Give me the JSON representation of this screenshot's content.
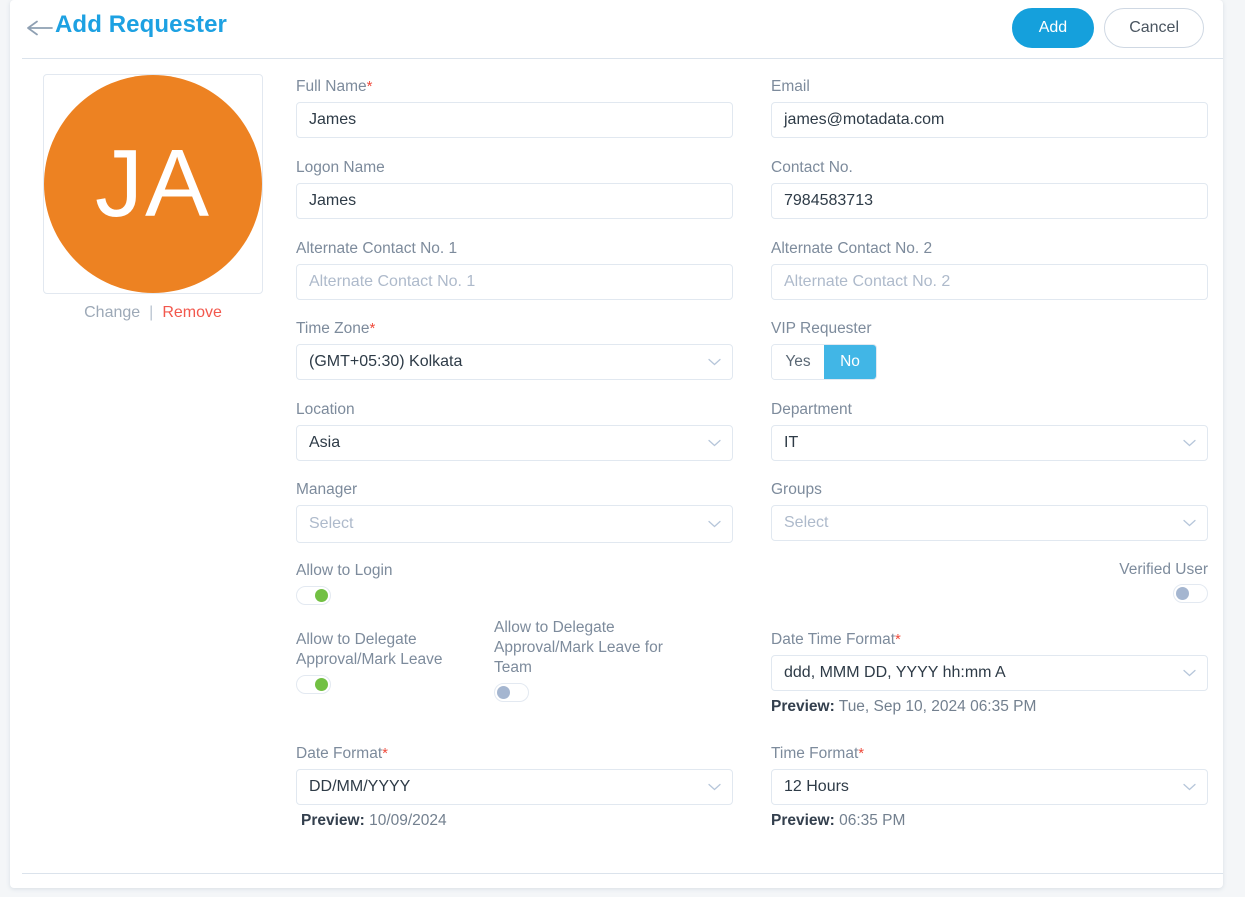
{
  "header": {
    "back_icon": "arrow-left-icon",
    "title": "Add Requester",
    "add_label": "Add",
    "cancel_label": "Cancel"
  },
  "avatar": {
    "initials": "JA",
    "color": "#ED8222",
    "change_label": "Change",
    "separator": "|",
    "remove_label": "Remove"
  },
  "form": {
    "full_name": {
      "label": "Full Name",
      "required": "*",
      "value": "James"
    },
    "email": {
      "label": "Email",
      "value": "james@motadata.com"
    },
    "logon_name": {
      "label": "Logon Name",
      "value": "James"
    },
    "contact_no": {
      "label": "Contact No.",
      "value": "7984583713"
    },
    "alternate_contact_1": {
      "label": "Alternate Contact No. 1",
      "placeholder": "Alternate Contact No. 1",
      "value": ""
    },
    "alternate_contact_2": {
      "label": "Alternate Contact No. 2",
      "placeholder": "Alternate Contact No. 2",
      "value": ""
    },
    "time_zone": {
      "label": "Time Zone",
      "required": "*",
      "value": "(GMT+05:30) Kolkata"
    },
    "vip_requester": {
      "label": "VIP Requester",
      "yes_label": "Yes",
      "no_label": "No",
      "selected": "No"
    },
    "location": {
      "label": "Location",
      "value": "Asia"
    },
    "department": {
      "label": "Department",
      "value": "IT"
    },
    "manager": {
      "label": "Manager",
      "placeholder": "Select"
    },
    "groups": {
      "label": "Groups",
      "placeholder": "Select"
    },
    "allow_to_login": {
      "label": "Allow to Login",
      "state": "on"
    },
    "verified_user": {
      "label": "Verified User",
      "state": "off"
    },
    "allow_delegate": {
      "label": "Allow to Delegate Approval/Mark Leave",
      "state": "on"
    },
    "allow_delegate_team": {
      "label": "Allow to Delegate Approval/Mark Leave for Team",
      "state": "off"
    },
    "date_time_format": {
      "label": "Date Time Format",
      "required": "*",
      "value": "ddd, MMM DD, YYYY hh:mm A",
      "preview_label": "Preview:",
      "preview_value": "Tue, Sep 10, 2024 06:35 PM"
    },
    "date_format": {
      "label": "Date Format",
      "required": "*",
      "value": "DD/MM/YYYY",
      "preview_label": "Preview:",
      "preview_value": "10/09/2024"
    },
    "time_format": {
      "label": "Time Format",
      "required": "*",
      "value": "12 Hours",
      "preview_label": "Preview:",
      "preview_value": "06:35 PM"
    }
  },
  "colors": {
    "accent": "#15A0DC",
    "title": "#1DA1E2",
    "avatar": "#ED8222",
    "toggle_on": "#72C043",
    "toggle_off": "#a5b6d0",
    "remove": "#F2584D",
    "segment_active": "#41B6E6",
    "required": "#ef4b3c"
  }
}
